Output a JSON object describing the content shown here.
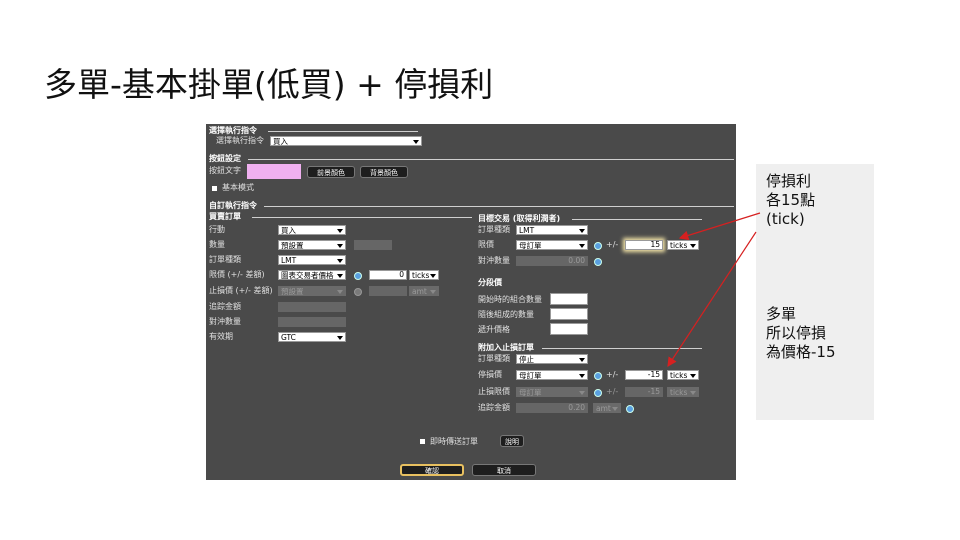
{
  "slide": {
    "title": "多單-基本掛單(低買) + 停損利"
  },
  "form": {
    "choose_section": "選擇執行指令",
    "choose_label": "選擇執行指令",
    "choose_value": "買入",
    "button_section": "按鈕設定",
    "button_text_label": "按鈕文字",
    "button_text_value": "",
    "front_color_btn": "前景顏色",
    "back_color_btn": "背景顏色",
    "basic_mode": "基本模式",
    "custom_section": "自訂執行指令",
    "buy_sell_section": "買賣訂單",
    "action_label": "行動",
    "action_value": "買入",
    "qty_label": "數量",
    "qty_value": "預設置",
    "order_type_label": "訂單種類",
    "order_type_value": "LMT",
    "limit_label": "限價 (+/- 差額)",
    "limit_value": "圖表交易者價格",
    "limit_offset": "0",
    "limit_unit": "ticks",
    "stop_label": "止損價 (+/- 差額)",
    "stop_value": "預設置",
    "stop_unit": "amt",
    "trail_label": "追踪金額",
    "hedge_label": "對沖數量",
    "tif_label": "有效期",
    "tif_value": "GTC",
    "target_section": "目標交易 (取得利潤者)",
    "t_order_type_label": "訂單種類",
    "t_order_type_value": "LMT",
    "t_limit_label": "限價",
    "t_limit_value": "母訂單",
    "t_pm": "+/-",
    "t_offset": "15",
    "t_unit": "ticks",
    "t_hedge_label": "對沖數量",
    "t_hedge_value": "0.00",
    "split_section": "分段價",
    "split_1": "開始時的組合數量",
    "split_2": "隨後組成的數量",
    "split_3": "遞升價格",
    "attached_section": "附加入止損訂單",
    "a_order_type_label": "訂單種類",
    "a_order_type_value": "停止",
    "a_stop_label": "停損價",
    "a_stop_value": "母訂單",
    "a_pm": "+/-",
    "a_offset": "-15",
    "a_unit": "ticks",
    "a_limit_label": "止損限價",
    "a_limit_value": "母訂單",
    "a_limit_pm": "+/-",
    "a_limit_offset": "-15",
    "a_limit_unit": "ticks",
    "a_trail_label": "追踪金額",
    "a_trail_value": "0.20",
    "a_trail_unit": "amt",
    "instant_send": "即時傳送訂單",
    "explain_btn": "說明",
    "ok_btn": "確認",
    "cancel_btn": "取消"
  },
  "notes": {
    "box_lines": [
      "停損利",
      "各15點",
      "(tick)",
      "多單",
      "所以停損",
      "為價格-15"
    ]
  },
  "colors": {
    "panel_bg": "#4a4a4a",
    "button_text_swatch": "#f0b0f0",
    "arrow_red": "#d62020",
    "note_bg": "#efefef"
  }
}
